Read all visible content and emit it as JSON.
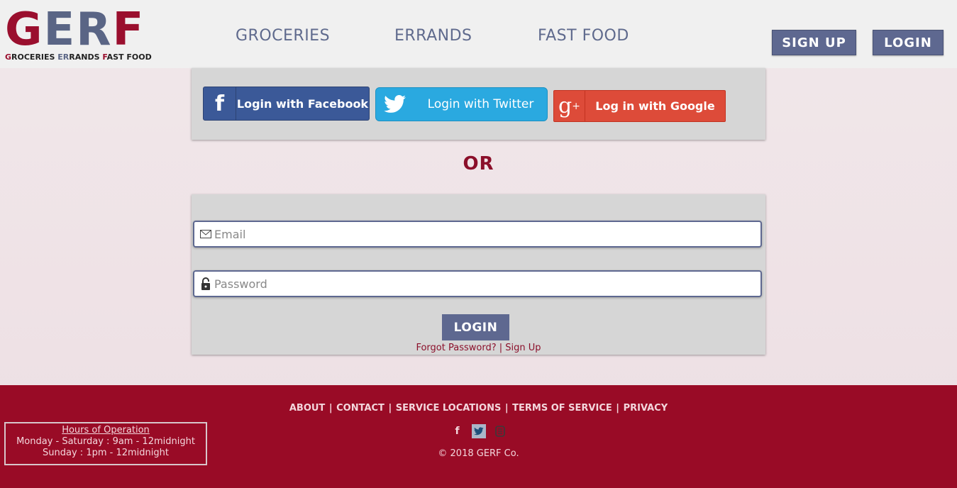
{
  "logo": {
    "g": "G",
    "er": "ER",
    "f": "F",
    "sub_g": "G",
    "sub_roceries": "ROCERIES ",
    "sub_er": "ER",
    "sub_rands": "RANDS ",
    "sub_f": "F",
    "sub_ast_food": "AST FOOD"
  },
  "nav": {
    "groceries": "GROCERIES",
    "errands": "ERRANDS",
    "fast_food": "FAST FOOD"
  },
  "header_buttons": {
    "sign_up": "SIGN UP",
    "login": "LOGIN"
  },
  "social": {
    "facebook_label": "Login with Facebook",
    "twitter_label": "Login with Twitter",
    "google_label": "Log in with Google",
    "facebook_icon": "facebook-icon",
    "twitter_icon": "twitter-icon",
    "google_icon": "google-plus-icon"
  },
  "or_text": "OR",
  "form": {
    "email_placeholder": "Email",
    "password_placeholder": "Password",
    "login_button": "LOGIN",
    "forgot_password": "Forgot Password?",
    "separator": " | ",
    "sign_up_link": "Sign Up"
  },
  "footer": {
    "nav": {
      "about": "ABOUT",
      "contact": "CONTACT",
      "service_locations": "SERVICE LOCATIONS",
      "terms": "TERMS OF SERVICE",
      "privacy": "PRIVACY",
      "sep": "|"
    },
    "hours": {
      "title": "Hours of Operation",
      "line1": "Monday - Saturday : 9am - 12midnight",
      "line2": "Sunday : 1pm - 12midnight"
    },
    "copyright": "© 2018 GERF Co."
  },
  "colors": {
    "brand_red": "#990b26",
    "brand_blue": "#5e6890",
    "facebook": "#3b5998",
    "twitter": "#2aa9e0",
    "google": "#dd4b39"
  }
}
